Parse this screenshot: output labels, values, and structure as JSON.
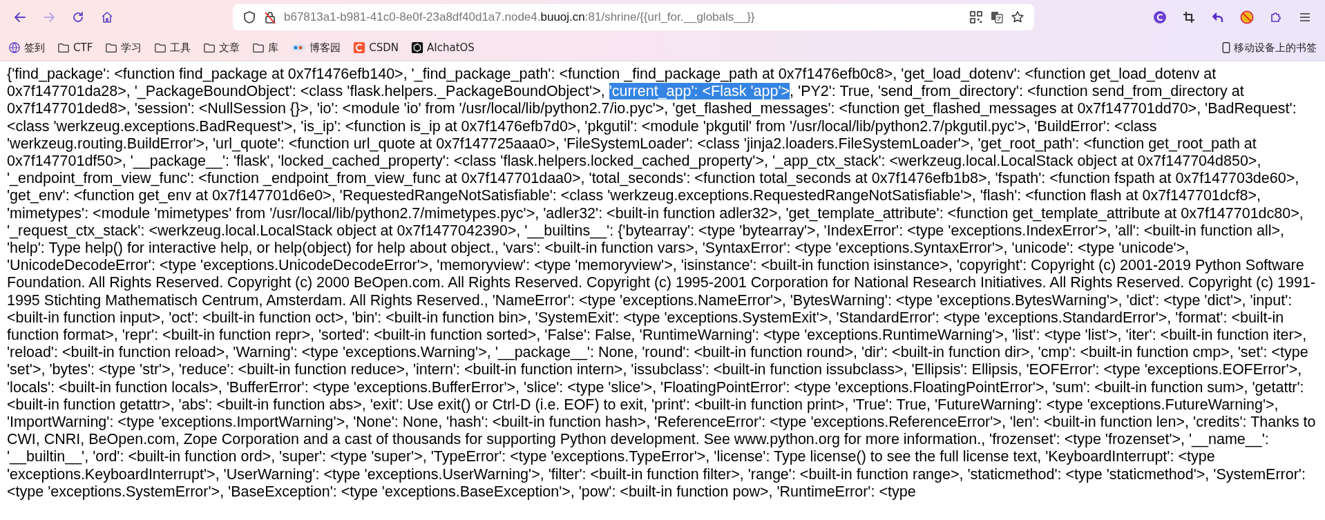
{
  "toolbar": {
    "nav_buttons": [
      {
        "kind": "back",
        "disabled": false
      },
      {
        "kind": "forward",
        "disabled": true
      },
      {
        "kind": "reload",
        "disabled": false
      },
      {
        "kind": "home",
        "disabled": false
      }
    ],
    "address": {
      "url_start": "b67813a1-b981-41c0-8e0f-23a8df40d1a7.node4.",
      "url_domain": "buuoj.cn",
      "url_end": ":81/shrine/{{url_for.__globals__}}"
    },
    "extensions": [
      {
        "kind": "profile"
      },
      {
        "kind": "crop"
      },
      {
        "kind": "undo"
      },
      {
        "kind": "blocked"
      },
      {
        "kind": "puzzle"
      },
      {
        "kind": "menu"
      }
    ]
  },
  "bookmarks": [
    {
      "label": "签到",
      "kind": "globe"
    },
    {
      "label": "CTF",
      "kind": "folder"
    },
    {
      "label": "学习",
      "kind": "folder"
    },
    {
      "label": "工具",
      "kind": "folder"
    },
    {
      "label": "文章",
      "kind": "folder"
    },
    {
      "label": "库",
      "kind": "folder"
    },
    {
      "label": "博客园",
      "kind": "blog"
    },
    {
      "label": "CSDN",
      "kind": "csdn"
    },
    {
      "label": "AIchatOS",
      "kind": "ai"
    }
  ],
  "mobile_bookmarks": "移动设备上的书签",
  "page": {
    "text_before": "{'find_package': <function find_package at 0x7f1476efb140>, '_find_package_path': <function _find_package_path at 0x7f1476efb0c8>, 'get_load_dotenv': <function get_load_dotenv at 0x7f147701da28>, '_PackageBoundObject': <class 'flask.helpers._PackageBoundObject'>, ",
    "selection": "'current_app': <Flask 'app'>",
    "text_after": ", 'PY2': True, 'send_from_directory': <function send_from_directory at 0x7f147701ded8>, 'session': <NullSession {}>, 'io': <module 'io' from '/usr/local/lib/python2.7/io.pyc'>, 'get_flashed_messages': <function get_flashed_messages at 0x7f147701dd70>, 'BadRequest': <class 'werkzeug.exceptions.BadRequest'>, 'is_ip': <function is_ip at 0x7f1476efb7d0>, 'pkgutil': <module 'pkgutil' from '/usr/local/lib/python2.7/pkgutil.pyc'>, 'BuildError': <class 'werkzeug.routing.BuildError'>, 'url_quote': <function url_quote at 0x7f147725aaa0>, 'FileSystemLoader': <class 'jinja2.loaders.FileSystemLoader'>, 'get_root_path': <function get_root_path at 0x7f147701df50>, '__package__': 'flask', 'locked_cached_property': <class 'flask.helpers.locked_cached_property'>, '_app_ctx_stack': <werkzeug.local.LocalStack object at 0x7f147704d850>, '_endpoint_from_view_func': <function _endpoint_from_view_func at 0x7f147701daa0>, 'total_seconds': <function total_seconds at 0x7f1476efb1b8>, 'fspath': <function fspath at 0x7f147703de60>, 'get_env': <function get_env at 0x7f147701d6e0>, 'RequestedRangeNotSatisfiable': <class 'werkzeug.exceptions.RequestedRangeNotSatisfiable'>, 'flash': <function flash at 0x7f147701dcf8>, 'mimetypes': <module 'mimetypes' from '/usr/local/lib/python2.7/mimetypes.pyc'>, 'adler32': <built-in function adler32>, 'get_template_attribute': <function get_template_attribute at 0x7f147701dc80>, '_request_ctx_stack': <werkzeug.local.LocalStack object at 0x7f1477042390>, '__builtins__': {'bytearray': <type 'bytearray'>, 'IndexError': <type 'exceptions.IndexError'>, 'all': <built-in function all>, 'help': Type help() for interactive help, or help(object) for help about object., 'vars': <built-in function vars>, 'SyntaxError': <type 'exceptions.SyntaxError'>, 'unicode': <type 'unicode'>, 'UnicodeDecodeError': <type 'exceptions.UnicodeDecodeError'>, 'memoryview': <type 'memoryview'>, 'isinstance': <built-in function isinstance>, 'copyright': Copyright (c) 2001-2019 Python Software Foundation. All Rights Reserved. Copyright (c) 2000 BeOpen.com. All Rights Reserved. Copyright (c) 1995-2001 Corporation for National Research Initiatives. All Rights Reserved. Copyright (c) 1991-1995 Stichting Mathematisch Centrum, Amsterdam. All Rights Reserved., 'NameError': <type 'exceptions.NameError'>, 'BytesWarning': <type 'exceptions.BytesWarning'>, 'dict': <type 'dict'>, 'input': <built-in function input>, 'oct': <built-in function oct>, 'bin': <built-in function bin>, 'SystemExit': <type 'exceptions.SystemExit'>, 'StandardError': <type 'exceptions.StandardError'>, 'format': <built-in function format>, 'repr': <built-in function repr>, 'sorted': <built-in function sorted>, 'False': False, 'RuntimeWarning': <type 'exceptions.RuntimeWarning'>, 'list': <type 'list'>, 'iter': <built-in function iter>, 'reload': <built-in function reload>, 'Warning': <type 'exceptions.Warning'>, '__package__': None, 'round': <built-in function round>, 'dir': <built-in function dir>, 'cmp': <built-in function cmp>, 'set': <type 'set'>, 'bytes': <type 'str'>, 'reduce': <built-in function reduce>, 'intern': <built-in function intern>, 'issubclass': <built-in function issubclass>, 'Ellipsis': Ellipsis, 'EOFError': <type 'exceptions.EOFError'>, 'locals': <built-in function locals>, 'BufferError': <type 'exceptions.BufferError'>, 'slice': <type 'slice'>, 'FloatingPointError': <type 'exceptions.FloatingPointError'>, 'sum': <built-in function sum>, 'getattr': <built-in function getattr>, 'abs': <built-in function abs>, 'exit': Use exit() or Ctrl-D (i.e. EOF) to exit, 'print': <built-in function print>, 'True': True, 'FutureWarning': <type 'exceptions.FutureWarning'>, 'ImportWarning': <type 'exceptions.ImportWarning'>, 'None': None, 'hash': <built-in function hash>, 'ReferenceError': <type 'exceptions.ReferenceError'>, 'len': <built-in function len>, 'credits': Thanks to CWI, CNRI, BeOpen.com, Zope Corporation and a cast of thousands for supporting Python development. See www.python.org for more information., 'frozenset': <type 'frozenset'>, '__name__': '__builtin__', 'ord': <built-in function ord>, 'super': <type 'super'>, 'TypeError': <type 'exceptions.TypeError'>, 'license': Type license() to see the full license text, 'KeyboardInterrupt': <type 'exceptions.KeyboardInterrupt'>, 'UserWarning': <type 'exceptions.UserWarning'>, 'filter': <built-in function filter>, 'range': <built-in function range>, 'staticmethod': <type 'staticmethod'>, 'SystemError': <type 'exceptions.SystemError'>, 'BaseException': <type 'exceptions.BaseException'>, 'pow': <built-in function pow>, 'RuntimeError': <type"
  }
}
